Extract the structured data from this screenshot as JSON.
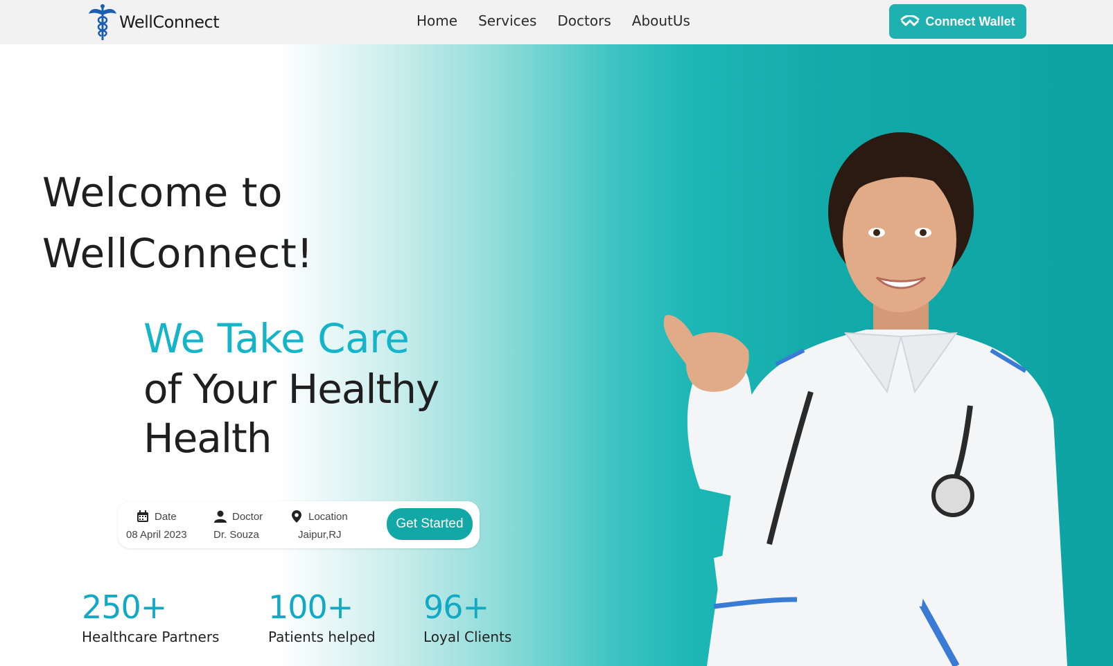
{
  "brand": {
    "name": "WellConnect",
    "logo_icon": "caduceus-icon"
  },
  "nav": {
    "items": [
      "Home",
      "Services",
      "Doctors",
      "AboutUs"
    ]
  },
  "wallet_button": {
    "label": "Connect Wallet",
    "icon": "wallet-connect-icon"
  },
  "hero": {
    "welcome_line1": "Welcome to",
    "welcome_line2": "WellConnect!",
    "tagline_highlight": "We Take Care",
    "tagline_line2": "of Your Healthy",
    "tagline_line3": "Health"
  },
  "booking": {
    "date_label": "Date",
    "date_value": "08 April 2023",
    "doctor_label": "Doctor",
    "doctor_value": "Dr. Souza",
    "location_label": "Location",
    "location_value": "Jaipur,RJ",
    "cta": "Get Started"
  },
  "stats": [
    {
      "value": "250+",
      "label": "Healthcare Partners"
    },
    {
      "value": "100+",
      "label": "Patients helped"
    },
    {
      "value": "96+",
      "label": "Loyal Clients"
    }
  ],
  "colors": {
    "accent": "#1fb0b0",
    "highlight_text": "#15b4c8",
    "nav_bg": "#f2f2f2",
    "hero_teal": "#0da3a2"
  }
}
